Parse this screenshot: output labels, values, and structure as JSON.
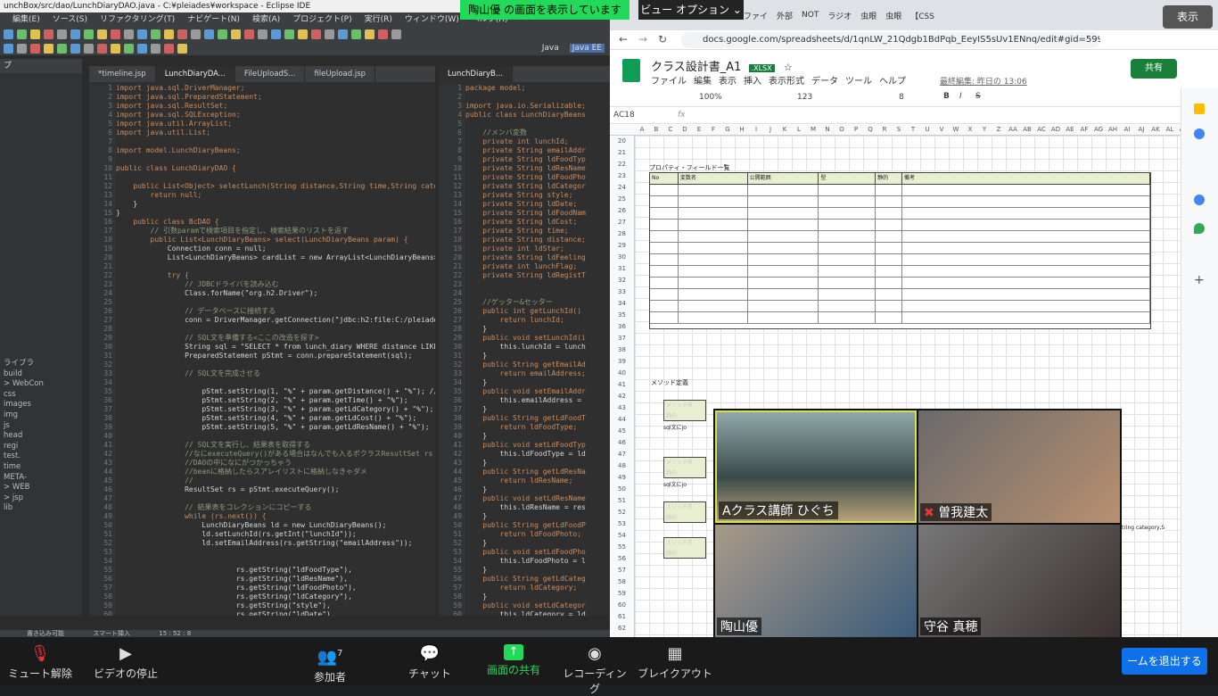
{
  "eclipse": {
    "title": "unchBox/src/dao/LunchDiaryDAO.java - C:¥pleiades¥workspace - Eclipse IDE",
    "menu": [
      "編集(E)",
      "ソース(S)",
      "リファクタリング(T)",
      "ナビゲート(N)",
      "検索(A)",
      "プロジェクト(P)",
      "実行(R)",
      "ウィンドウ(W)",
      "ヘルプ(H)"
    ],
    "perspectives": [
      "Java",
      "Java EE"
    ],
    "package_explorer_title": "プ",
    "tree": [
      "ライブラ",
      "build",
      "> WebCon",
      "css",
      "images",
      "img",
      "js",
      "head",
      "regi",
      "test.",
      "time",
      "META-",
      "> WEB",
      "> jsp",
      "lib"
    ],
    "tabs_a": [
      "*timeline.jsp",
      "LunchDiaryDA...",
      "FileUploadS...",
      "fileUpload.jsp"
    ],
    "tabs_b": [
      "LunchDiaryB..."
    ],
    "code_a_start": 1,
    "code_a": [
      "import java.sql.DriverManager;",
      "import java.sql.PreparedStatement;",
      "import java.sql.ResultSet;",
      "import java.sql.SQLException;",
      "import java.util.ArrayList;",
      "import java.util.List;",
      "",
      "import model.LunchDiaryBeans;",
      "",
      "public class LunchDiaryDAO {",
      "",
      "    public List<Object> selectLunch(String distance,String time,String category",
      "        return null;",
      "    }",
      "}",
      "    public class BcDAO {",
      "        // 引数paramで検索項目を指定し、検索結果のリストを返す",
      "        public List<LunchDiaryBeans> select(LunchDiaryBeans param) {",
      "            Connection conn = null;",
      "            List<LunchDiaryBeans> cardList = new ArrayList<LunchDiaryBeans>();",
      "",
      "            try {",
      "                // JDBCドライバを読み込む",
      "                Class.forName(\"org.h2.Driver\");",
      "",
      "                // データベースに接続する",
      "                conn = DriverManager.getConnection(\"jdbc:h2:file:C:/pleiades/wo",
      "",
      "                // SQL文を準備する<ここの改造を探す>",
      "                String sql = \"SELECT * from lunch_diary WHERE distance LIKE ? A",
      "                PreparedStatement pStmt = conn.prepareStatement(sql);",
      "",
      "                // SQL文を完成させる",
      "",
      "                    pStmt.setString(1, \"%\" + param.getDistance() + \"%\"); //%はワ",
      "                    pStmt.setString(2, \"%\" + param.getTime() + \"%\");",
      "                    pStmt.setString(3, \"%\" + param.getLdCategory() + \"%\");",
      "                    pStmt.setString(4, \"%\" + param.getLdCost() + \"%\");",
      "                    pStmt.setString(5, \"%\" + param.getLdResName() + \"%\");",
      "",
      "                // SQL文を実行し、結果表を取得する",
      "                //なにexecuteQuery()がある場合はなんでも入るポクラスResultSet rs を入れる",
      "                //DAOの中になにがつかっちゃう",
      "                //beanに格納したらスアレイリストに格納しなきゃダメ",
      "                //",
      "                ResultSet rs = pStmt.executeQuery();",
      "",
      "                // 結果表をコレクションにコピーする",
      "                while (rs.next()) {",
      "                    LunchDiaryBeans ld = new LunchDiaryBeans();",
      "                    ld.setLunchId(rs.getInt(\"lunchId\"));",
      "                    ld.setEmailAddress(rs.getString(\"emailAddress\"));",
      "",
      "",
      "                            rs.getString(\"ldFoodType\"),",
      "                            rs.getString(\"ldResName\"),",
      "                            rs.getString(\"ldFoodPhoto\"),",
      "                            rs.getString(\"ldCategory\"),",
      "                            rs.getString(\"style\"),",
      "                            rs.getString(\"ldDate\"),",
      "                            rs.getString(\"ldFoodName\"),"
    ],
    "code_b": [
      "package model;",
      "",
      "import java.io.Serializable;",
      "public class LunchDiaryBeans",
      "",
      "    //メンバ変数",
      "    private int lunchId;",
      "    private String emailAddr",
      "    private String ldFoodTyp",
      "    private String ldResName",
      "    private String ldFoodPho",
      "    private String ldCategor",
      "    private String style;",
      "    private String ldDate;",
      "    private String ldFoodNam",
      "    private String ldCost;",
      "    private String time;",
      "    private String distance;",
      "    private int ldStar;",
      "    private String ldFeeling",
      "    private int lunchFlag;",
      "    private String ldRegistT",
      "",
      "",
      "    //ゲッター&セッター",
      "    public int getLunchId()",
      "        return lunchId;",
      "    }",
      "    public void setLunchId(i",
      "        this.lunchId = lunch",
      "    }",
      "    public String getEmailAd",
      "        return emailAddress;",
      "    }",
      "    public void setEmailAddr",
      "        this.emailAddress =",
      "    }",
      "    public String getLdFoodT",
      "        return ldFoodType;",
      "    }",
      "    public void setLdFoodTyp",
      "        this.ldFoodType = ld",
      "    }",
      "    public String getLdResNa",
      "        return ldResName;",
      "    }",
      "    public void setLdResName",
      "        this.ldResName = res",
      "    }",
      "    public String getLdFoodP",
      "        return ldFoodPhoto;",
      "    }",
      "    public void setLdFoodPho",
      "        this.ldFoodPhoto = l",
      "    }",
      "    public String getLdCateg",
      "        return ldCategory;",
      "    }",
      "    public void setLdCategor",
      "        this.ldCategory = ld"
    ],
    "status": [
      "書き込み可能",
      "スマート挿入",
      "15 : 52 : 8"
    ]
  },
  "chrome": {
    "tabs": [
      "ファイ",
      "外部",
      "NOT",
      "ラジオ",
      "虫眼",
      "虫眼",
      "【CSS"
    ],
    "url": "docs.google.com/spreadsheets/d/1qnLW_21Qdgb1BdPqb_EeyIS5sUv1ENnq/edit#gid=599971633",
    "doc_title": "クラス設計書_A1",
    "badge": ".XLSX",
    "menu": [
      "ファイル",
      "編集",
      "表示",
      "挿入",
      "表示形式",
      "データ",
      "ツール",
      "ヘルプ"
    ],
    "last_edit": "最終編集: 昨日の 13:06",
    "share_label": "共有",
    "zoom": "100%",
    "font_size": "8",
    "num_format": "123",
    "cell_ref": "AC18",
    "fx_label": "fx",
    "columns": [
      "A",
      "B",
      "C",
      "D",
      "E",
      "F",
      "G",
      "H",
      "I",
      "J",
      "K",
      "L",
      "M",
      "N",
      "O",
      "P",
      "Q",
      "R",
      "S",
      "T",
      "U",
      "V",
      "W",
      "X",
      "Y",
      "Z",
      "AA",
      "AB",
      "AC",
      "AD",
      "AE",
      "AF",
      "AG",
      "AH",
      "AI",
      "AJ",
      "AK",
      "AL",
      "AM"
    ],
    "rows": [
      "20",
      "21",
      "22",
      "23",
      "24",
      "25",
      "26",
      "27",
      "28",
      "29",
      "30",
      "31",
      "32",
      "33",
      "34",
      "35",
      "36",
      "37",
      "38",
      "39",
      "40",
      "41",
      "42",
      "43",
      "44",
      "45",
      "46",
      "47",
      "48",
      "49",
      "50",
      "51",
      "52",
      "53",
      "54",
      "55",
      "56",
      "57",
      "58",
      "59",
      "60",
      "61",
      "62"
    ],
    "prop_title": "プロパティ・フィールド一覧",
    "prop_headers": [
      "No",
      "変数名",
      "公開範囲",
      "型",
      "静的",
      "備考"
    ],
    "method_title": "メソッド定義",
    "method_label": "メソッド名",
    "static_label": "静的",
    "sql_note": "sql文にjo",
    "overflow_text": "tring category,S"
  },
  "zoom": {
    "banner": "陶山優 の画面を表示しています",
    "view_options": "ビュー オプション",
    "show": "表示",
    "toolbar": [
      {
        "label": "ミュート解除",
        "icon": "mic-muted-icon"
      },
      {
        "label": "ビデオの停止",
        "icon": "video-icon"
      },
      {
        "label": "参加者",
        "icon": "participants-icon",
        "count": "7"
      },
      {
        "label": "チャット",
        "icon": "chat-icon"
      },
      {
        "label": "画面の共有",
        "icon": "share-screen-icon"
      },
      {
        "label": "レコーディング",
        "icon": "record-icon"
      },
      {
        "label": "ブレイクアウト",
        "icon": "breakout-icon"
      }
    ],
    "leave": "ームを退出する",
    "participants": [
      "Aクラス講師 ひぐち",
      "曽我建太",
      "陶山優",
      "守谷 真穂"
    ],
    "colors": {
      "share_green": "#23d959",
      "leave_blue": "#0e71eb",
      "bar": "#1a1a1a"
    }
  }
}
